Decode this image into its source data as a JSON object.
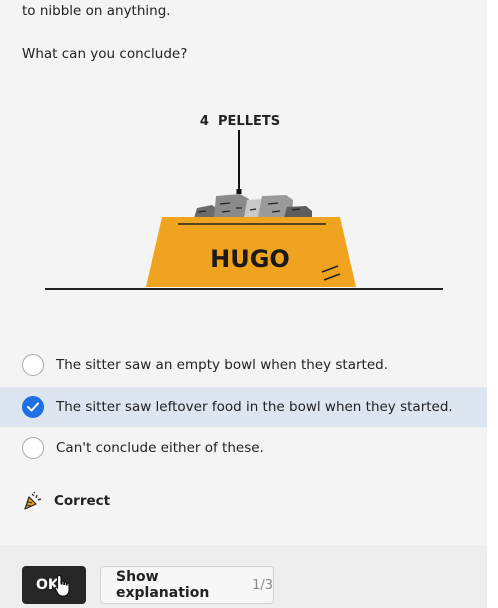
{
  "question": {
    "text_tail": "to nibble on anything.",
    "prompt": "What can you conclude?"
  },
  "illustration": {
    "pellet_label": "4  PELLETS",
    "bowl_name": "HUGO"
  },
  "options": [
    {
      "label": "The sitter saw an empty bowl when they started.",
      "selected": false
    },
    {
      "label": "The sitter saw leftover food in the bowl when they started.",
      "selected": true
    },
    {
      "label": "Can't conclude either of these.",
      "selected": false
    }
  ],
  "feedback": {
    "label": "Correct",
    "icon": "party-popper-icon"
  },
  "buttons": {
    "ok_label": "OK",
    "explanation_label": "Show explanation",
    "explanation_count": "1/3"
  },
  "colors": {
    "accent": "#1f6fe5",
    "selected_row": "#dde5f1",
    "bowl": "#f0a31f"
  }
}
